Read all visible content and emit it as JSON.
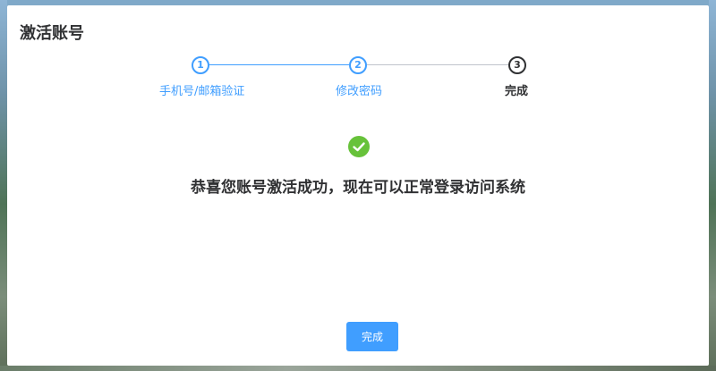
{
  "dialog": {
    "title": "激活账号",
    "steps": [
      {
        "number": "1",
        "label": "手机号/邮箱验证"
      },
      {
        "number": "2",
        "label": "修改密码"
      },
      {
        "number": "3",
        "label": "完成"
      }
    ],
    "success_icon": "check-circle-icon",
    "success_message": "恭喜您账号激活成功，现在可以正常登录访问系统",
    "done_button_label": "完成"
  },
  "colors": {
    "primary": "#409eff",
    "success": "#67c23a",
    "text": "#303133",
    "inactive_line": "#c0c4cc"
  }
}
